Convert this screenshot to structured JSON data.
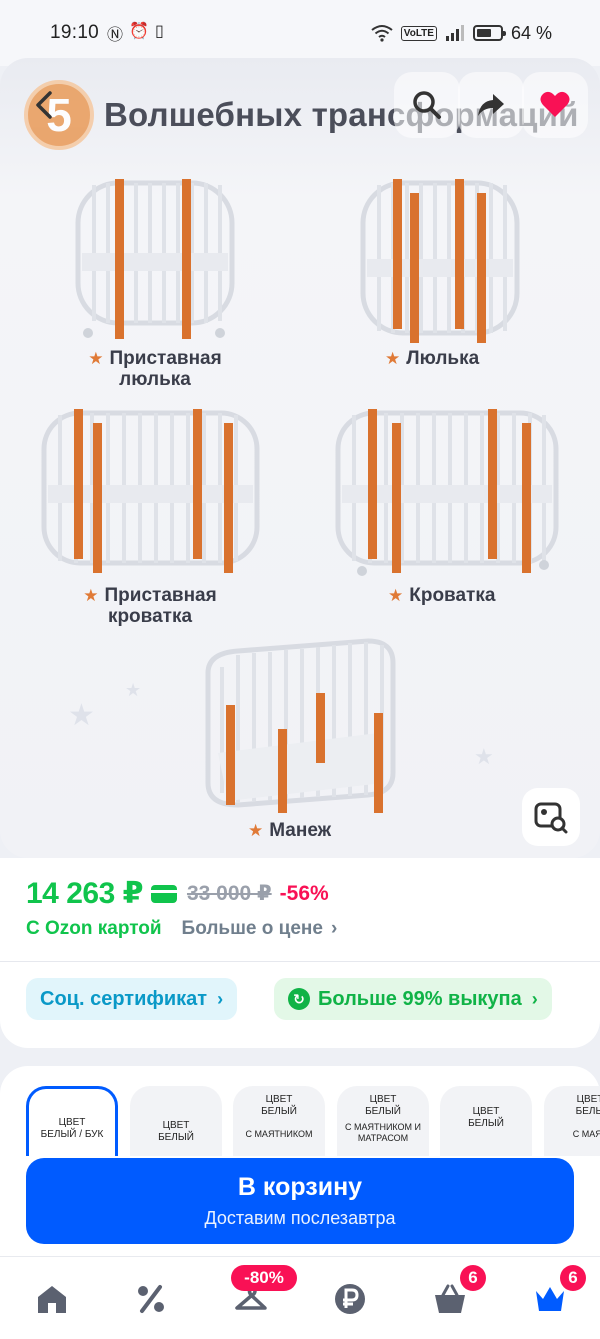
{
  "status_bar": {
    "time": "19:10",
    "left_icons": [
      "nfc-icon",
      "alarm-icon",
      "vibrate-icon"
    ],
    "volte": "VoLTE",
    "battery_percent": "64 %",
    "battery_level": 0.64
  },
  "gallery": {
    "banner_title": "Волшебных трансформаций",
    "logo_text": "5",
    "labels": {
      "attached_cradle": "Приставная люлька",
      "cradle": "Люлька",
      "attached_crib": "Приставная кроватка",
      "crib": "Кроватка",
      "playpen": "Манеж"
    }
  },
  "price": {
    "current": "14 263 ₽",
    "old": "33 000 ₽",
    "discount": "-56%",
    "ozon_card": "С Ozon картой",
    "more_about_price": "Больше о цене"
  },
  "badges": {
    "certificate": "Соц. сертификат",
    "buyout": "Больше 99% выкупа"
  },
  "variants": [
    {
      "line1": "ЦВЕТ",
      "line2": "БЕЛЫЙ / БУК",
      "line3": ""
    },
    {
      "line1": "ЦВЕТ",
      "line2": "БЕЛЫЙ",
      "line3": ""
    },
    {
      "line1": "ЦВЕТ",
      "line2": "БЕЛЫЙ",
      "line3": "С МАЯТНИКОМ"
    },
    {
      "line1": "ЦВЕТ",
      "line2": "БЕЛЫЙ",
      "line3": "С МАЯТНИКОМ И МАТРАСОМ"
    },
    {
      "line1": "ЦВЕТ",
      "line2": "БЕЛЫЙ",
      "line3": ""
    },
    {
      "line1": "ЦВЕТ",
      "line2": "БЕЛЫ",
      "line3": "С МАЯТ"
    }
  ],
  "cart": {
    "title": "В корзину",
    "subtitle": "Доставим послезавтра"
  },
  "bottom_nav": {
    "promo_badge": "-80%",
    "cart_count": "6",
    "profile_count": "6"
  },
  "colors": {
    "accent_blue": "#005bff",
    "price_green": "#10c44c",
    "discount_red": "#f91155",
    "wood_orange": "#d9722e"
  }
}
